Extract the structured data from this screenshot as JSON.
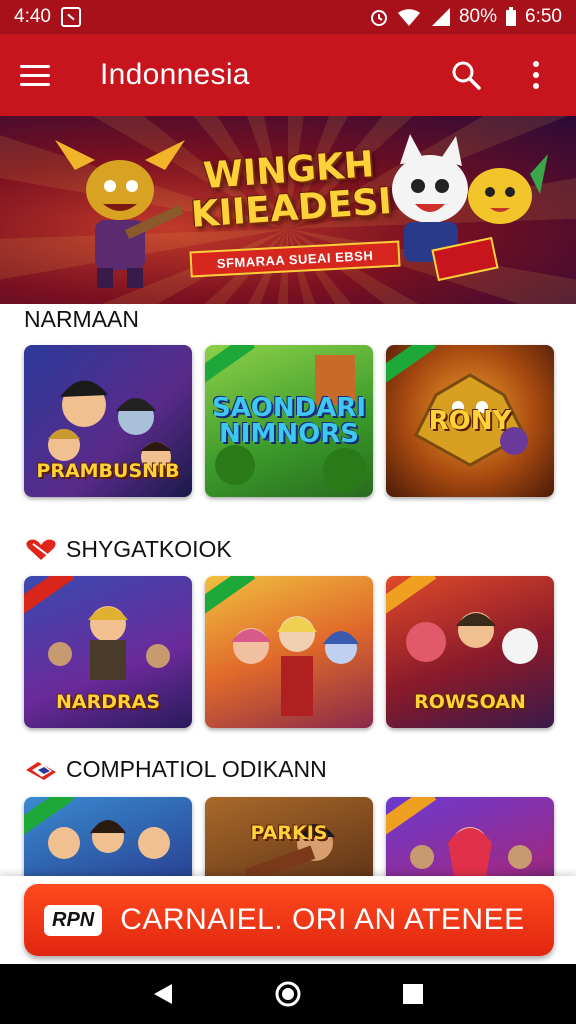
{
  "status_bar": {
    "time_left": "4:40",
    "battery_percent": "80%",
    "time_right": "6:50"
  },
  "app_bar": {
    "title": "Indonnesia",
    "icons": [
      "menu-icon",
      "search-icon",
      "more-vert-icon"
    ]
  },
  "banner": {
    "title_line1": "WINGKH",
    "title_line2": "KIIEADESI",
    "subtitle": "SFMARAA SUEAI EBSH"
  },
  "sections": [
    {
      "title": "NARMAAN",
      "tiles": [
        {
          "label": "PRAMBUSNIB"
        },
        {
          "label": "SAONDARI NIMNORS"
        },
        {
          "label": "RONY"
        }
      ]
    },
    {
      "title": "SHYGATKOIOK",
      "tiles": [
        {
          "label": "NARDRAS"
        },
        {
          "label": ""
        },
        {
          "label": "ROWSOAN"
        }
      ]
    },
    {
      "title": "COMPHATIOL ODIKANN",
      "tiles": [
        {
          "label": ""
        },
        {
          "label": "PARKIS"
        },
        {
          "label": ""
        }
      ]
    }
  ],
  "cta": {
    "badge": "RPN",
    "label": "CARNAIEL. ORI AN ATENEE"
  },
  "colors": {
    "primary": "#c8141d",
    "status": "#a8101a",
    "cta": "#f03a16"
  }
}
